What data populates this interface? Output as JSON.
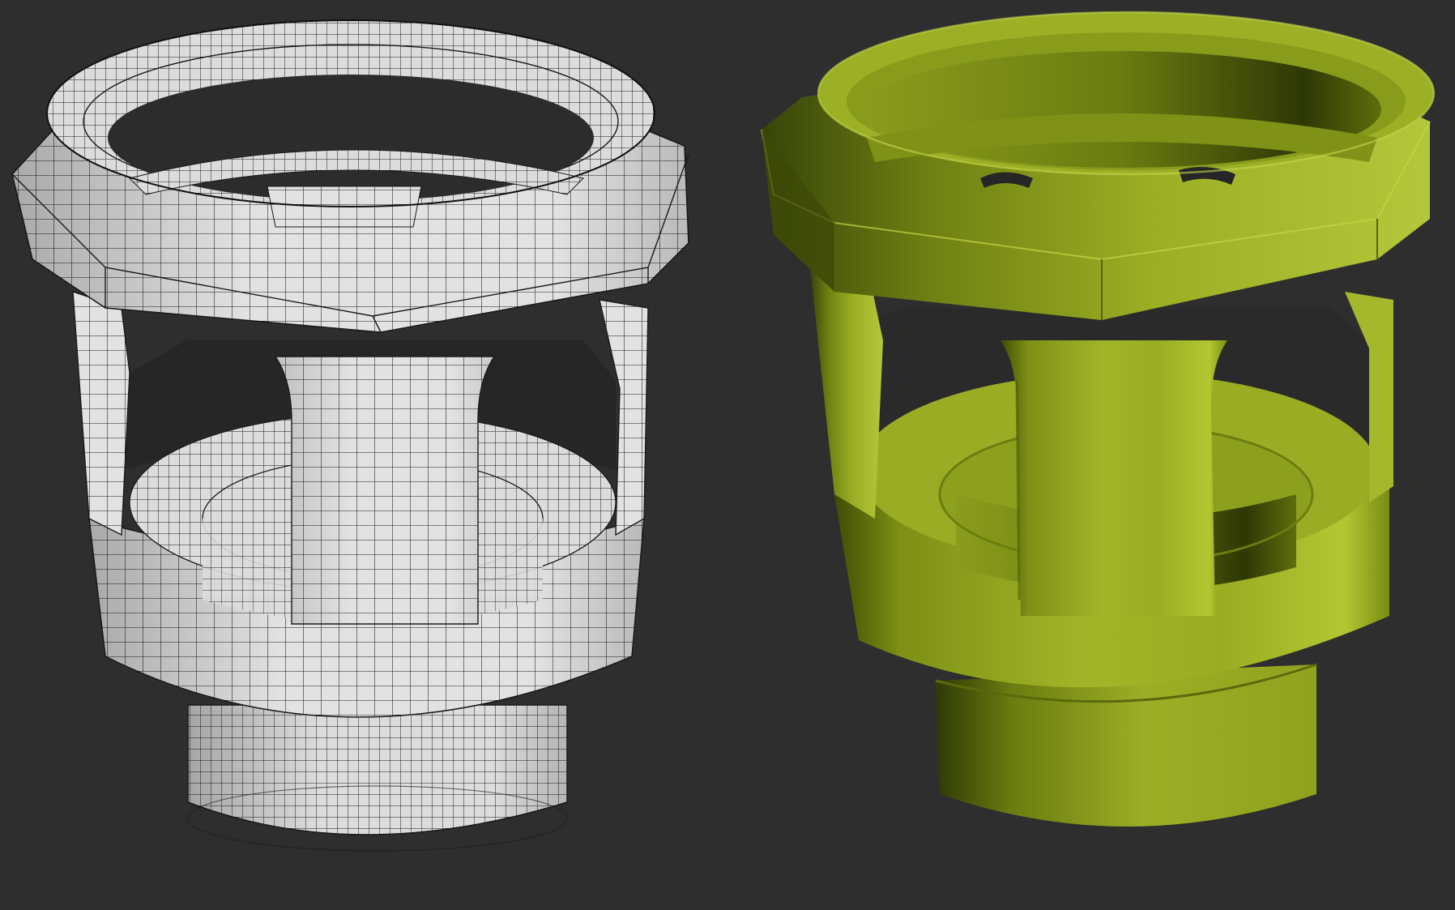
{
  "scene": {
    "background_color": "#2e2e2e",
    "models": [
      {
        "id": "wireframe",
        "shading": "wireframe",
        "surface_color": "#e4e4e4",
        "edge_color": "#1a1a1a"
      },
      {
        "id": "shaded",
        "shading": "smooth",
        "surface_color": "#9fb223",
        "shadow_color": "#4a5a08"
      }
    ]
  }
}
